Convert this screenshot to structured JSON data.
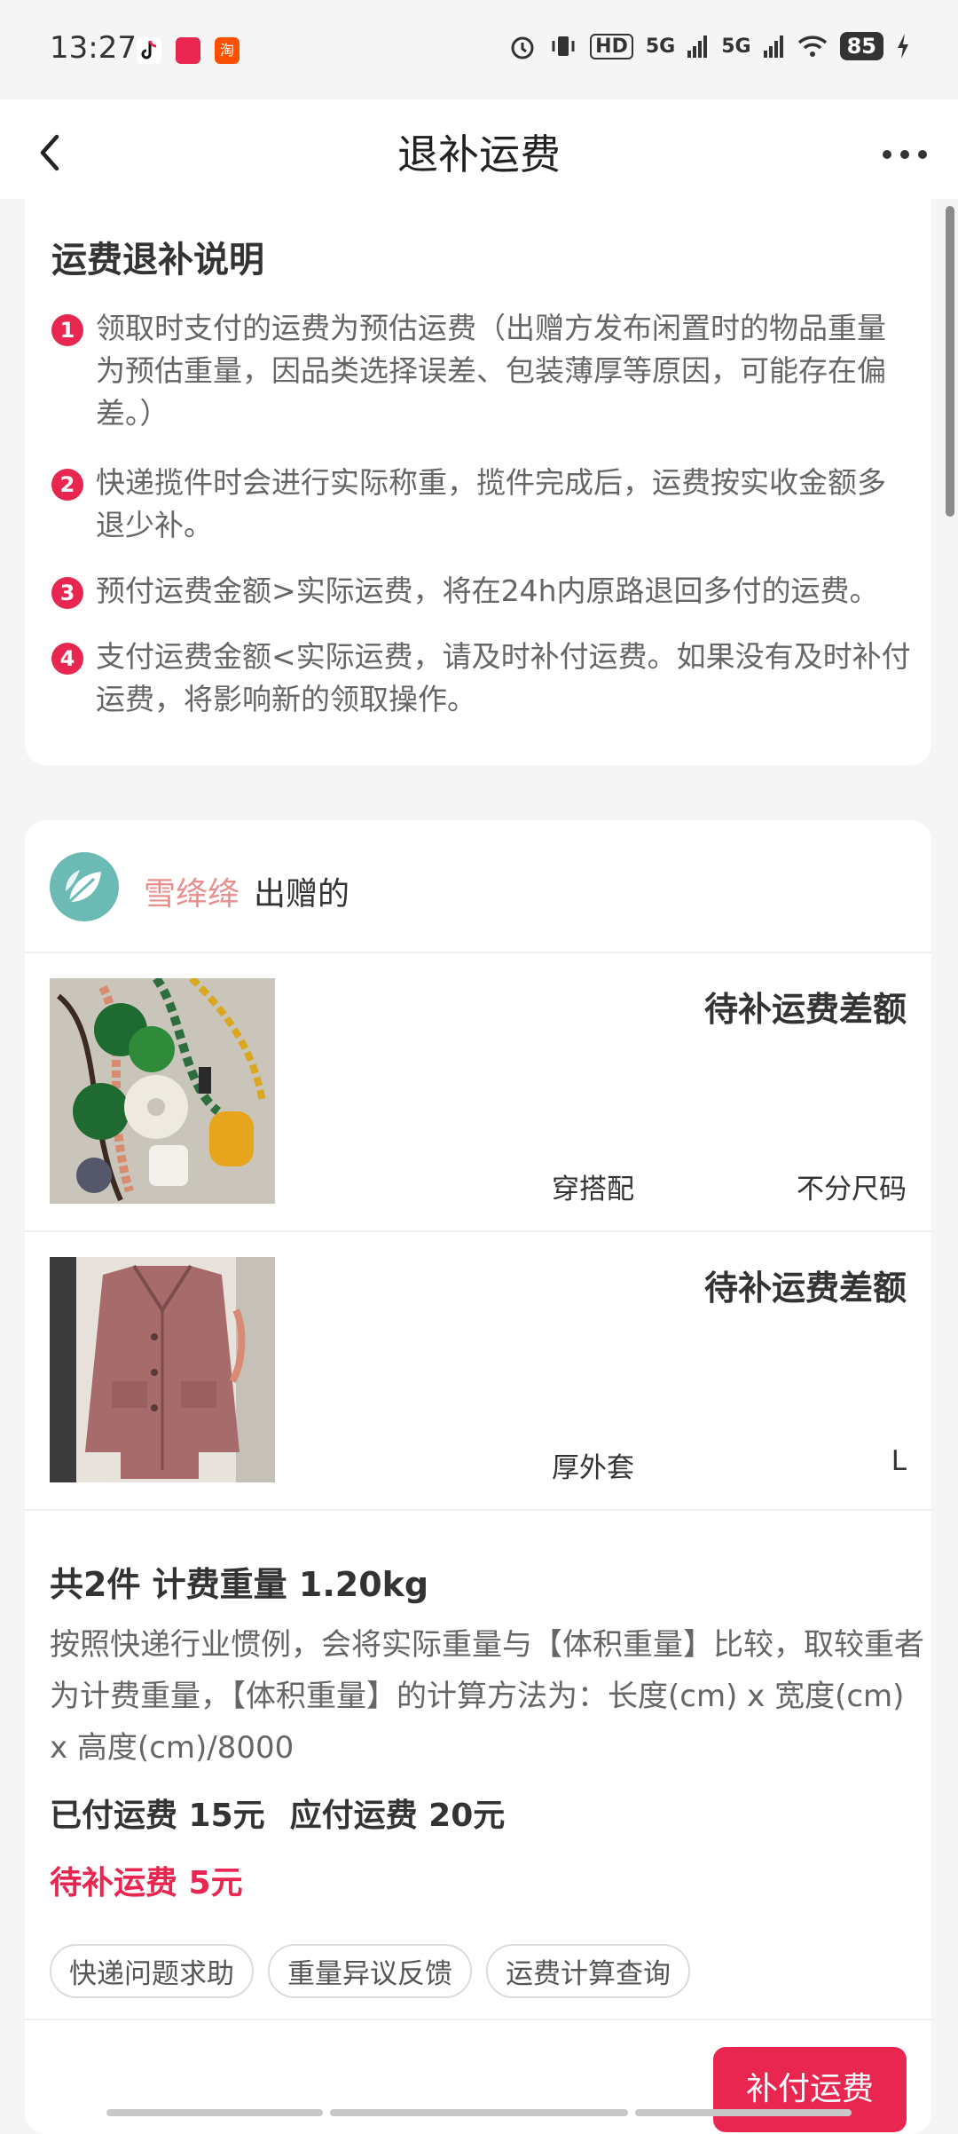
{
  "status": {
    "time": "13:27",
    "apps": [
      {
        "name": "tiktok-icon",
        "color": "#111111"
      },
      {
        "name": "taobao-shop-icon",
        "color": "#e8264f"
      },
      {
        "name": "taobao-icon",
        "color": "#ff5000"
      }
    ],
    "net1": "HD",
    "net2": "5G",
    "net3": "5G",
    "battery": "85"
  },
  "nav": {
    "title": "退补运费"
  },
  "info": {
    "title": "运费退补说明",
    "rules": [
      {
        "num": "1",
        "text": "领取时支付的运费为预估运费（出赠方发布闲置时的物品重量为预估重量，因品类选择误差、包装薄厚等原因，可能存在偏差。）"
      },
      {
        "num": "2",
        "text": "快递揽件时会进行实际称重，揽件完成后，运费按实收金额多退少补。"
      },
      {
        "num": "3",
        "text": "预付运费金额>实际运费，将在24h内原路退回多付的运费。"
      },
      {
        "num": "4",
        "text": "支付运费金额<实际运费，请及时补付运费。如果没有及时补付运费，将影响新的领取操作。"
      }
    ]
  },
  "order": {
    "seller_name": "雪绛绛",
    "seller_suffix": "出赠的",
    "items": [
      {
        "status": "待补运费差额",
        "category": "穿搭配",
        "size": "不分尺码",
        "image": "jade-jewelry-photo"
      },
      {
        "status": "待补运费差额",
        "category": "厚外套",
        "size": "L",
        "image": "pink-coat-photo"
      }
    ],
    "summary_title": "共2件 计费重量 1.20kg",
    "summary_desc": "按照快递行业惯例，会将实际重量与【体积重量】比较，取较重者为计费重量，【体积重量】的计算方法为：长度(cm) x 宽度(cm) x 高度(cm)/8000",
    "paid": "已付运费 15元",
    "due": "应付运费 20元",
    "pending": "待补运费 5元",
    "tags": [
      "快递问题求助",
      "重量异议反馈",
      "运费计算查询"
    ],
    "pay_button": "补付运费"
  },
  "colors": {
    "accent": "#e8264f",
    "seller": "#e88f8f",
    "avatar": "#6bbab4"
  }
}
